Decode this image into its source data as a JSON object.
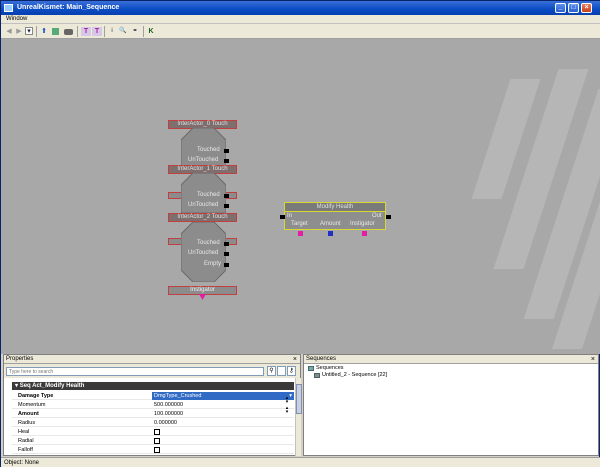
{
  "window": {
    "title": "UnrealKismet: Main_Sequence"
  },
  "menu": {
    "window": "Window"
  },
  "toolbar": {
    "back_glyph": "◀",
    "fwd_glyph": "▶",
    "drop_glyph": "▾",
    "up_glyph": "⬆",
    "t1": "T",
    "t2": "T",
    "zoom_glyph": "🔍",
    "k_glyph": "K"
  },
  "nodes": {
    "touch0": {
      "title": "InterActor_0 Touch",
      "out1": "Touched",
      "out2": "UnTouched"
    },
    "touch1": {
      "title": "InterActor_1 Touch",
      "out1": "Touched",
      "out2": "UnTouched"
    },
    "touch2": {
      "title": "InterActor_2 Touch",
      "out1": "Touched",
      "out2": "UnTouched",
      "out3": "Empty"
    },
    "instigator": "Instigator",
    "modify": {
      "title": "Modify Health",
      "in": "In",
      "out": "Out",
      "target": "Target",
      "amount": "Amount",
      "instigator": "Instigator"
    }
  },
  "properties": {
    "title": "Properties",
    "search_placeholder": "Type here to search",
    "category": "Seq Act_Modify Health",
    "rows": {
      "damage_type": {
        "name": "Damage Type",
        "value": "DmgType_Crushed"
      },
      "momentum": {
        "name": "Momentum",
        "value": "500.000000"
      },
      "amount": {
        "name": "Amount",
        "value": "100.000000"
      },
      "radius": {
        "name": "Radius",
        "value": "0.000000"
      },
      "heal": {
        "name": "Heal"
      },
      "radial": {
        "name": "Radial"
      },
      "falloff": {
        "name": "Falloff"
      }
    }
  },
  "sequences": {
    "title": "Sequences",
    "root": "Sequences",
    "child": "Untitled_2 - Sequence [22]"
  },
  "status": {
    "text": "Object: None"
  },
  "colors": {
    "title_bar": "#0a4bc4",
    "canvas": "#a8a8a8",
    "node_border": "#c04040",
    "selected": "#d8d830",
    "pink_var": "#e020a0",
    "blue_var": "#2030c0"
  }
}
